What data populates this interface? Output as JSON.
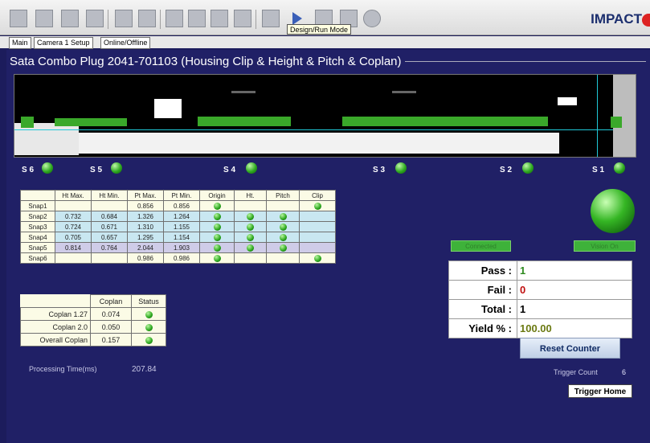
{
  "toolbar": {
    "tooltip": "Design/Run Mode",
    "brand": "IMPACT"
  },
  "tabs": [
    "Main",
    "Camera 1 Setup",
    "Online/Offline"
  ],
  "title": "Sata Combo Plug 2041-701103 (Housing Clip & Height & Pitch & Coplan)",
  "slots": [
    {
      "label": "S 6"
    },
    {
      "label": "S 5"
    },
    {
      "label": "S 4"
    },
    {
      "label": "S 3"
    },
    {
      "label": "S 2"
    },
    {
      "label": "S 1"
    }
  ],
  "snap_table": {
    "headers": [
      "",
      "Ht Max.",
      "Ht Min.",
      "Pt Max.",
      "Pt Min.",
      "Origin",
      "Ht.",
      "Pitch",
      "Clip"
    ],
    "rows": [
      {
        "name": "Snap1",
        "ht_max": "",
        "ht_min": "",
        "pt_max": "0.856",
        "pt_min": "0.856"
      },
      {
        "name": "Snap2",
        "ht_max": "0.732",
        "ht_min": "0.684",
        "pt_max": "1.326",
        "pt_min": "1.264"
      },
      {
        "name": "Snap3",
        "ht_max": "0.724",
        "ht_min": "0.671",
        "pt_max": "1.310",
        "pt_min": "1.155"
      },
      {
        "name": "Snap4",
        "ht_max": "0.705",
        "ht_min": "0.657",
        "pt_max": "1.295",
        "pt_min": "1.154"
      },
      {
        "name": "Snap5",
        "ht_max": "0.814",
        "ht_min": "0.764",
        "pt_max": "2.044",
        "pt_min": "1.903"
      },
      {
        "name": "Snap6",
        "ht_max": "",
        "ht_min": "",
        "pt_max": "0.986",
        "pt_min": "0.986"
      }
    ]
  },
  "coplan_table": {
    "headers": [
      "",
      "Coplan",
      "Status"
    ],
    "rows": [
      {
        "name": "Coplan 1.27",
        "value": "0.074"
      },
      {
        "name": "Coplan 2.0",
        "value": "0.050"
      },
      {
        "name": "Overall Coplan",
        "value": "0.157"
      }
    ]
  },
  "processing": {
    "label": "Processing Time(ms)",
    "value": "207.84"
  },
  "status": {
    "connected": "Connected",
    "vision": "Vision On"
  },
  "stats": {
    "pass_label": "Pass :",
    "pass": "1",
    "fail_label": "Fail :",
    "fail": "0",
    "total_label": "Total :",
    "total": "1",
    "yield_label": "Yield % :",
    "yield": "100.00"
  },
  "reset_label": "Reset Counter",
  "trigger": {
    "label": "Trigger Count",
    "value": "6",
    "home_label": "Trigger Home"
  },
  "colors": {
    "pass": "#2e8b1f",
    "fail": "#c01010",
    "yield": "#6b7a12",
    "panel": "#202066"
  }
}
